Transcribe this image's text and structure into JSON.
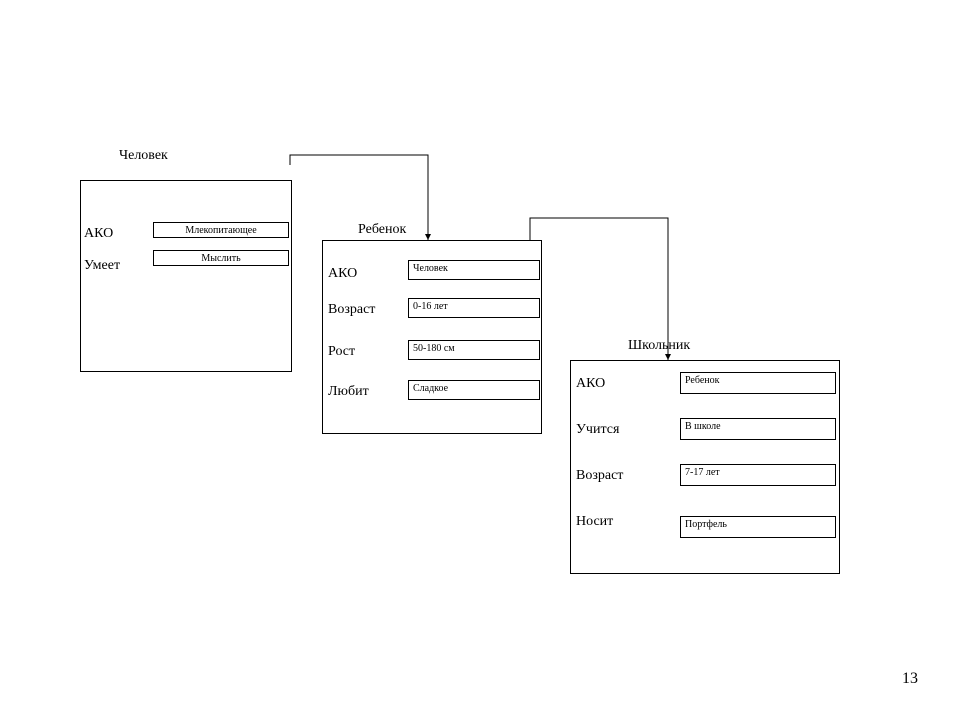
{
  "page_number": "13",
  "frames": [
    {
      "title": "Человек",
      "slots": [
        {
          "label": "АКО",
          "value": "Млекопитающее"
        },
        {
          "label": "Умеет",
          "value": "Мыслить"
        }
      ]
    },
    {
      "title": "Ребенок",
      "slots": [
        {
          "label": "АКО",
          "value": "Человек"
        },
        {
          "label": "Возраст",
          "value": "0-16 лет"
        },
        {
          "label": "Рост",
          "value": "50-180 см"
        },
        {
          "label": "Любит",
          "value": "Сладкое"
        }
      ]
    },
    {
      "title": "Школьник",
      "slots": [
        {
          "label": "АКО",
          "value": "Ребенок"
        },
        {
          "label": "Учится",
          "value": "В школе"
        },
        {
          "label": "Возраст",
          "value": "7-17 лет"
        },
        {
          "label": "Носит",
          "value": "Портфель"
        }
      ]
    }
  ]
}
